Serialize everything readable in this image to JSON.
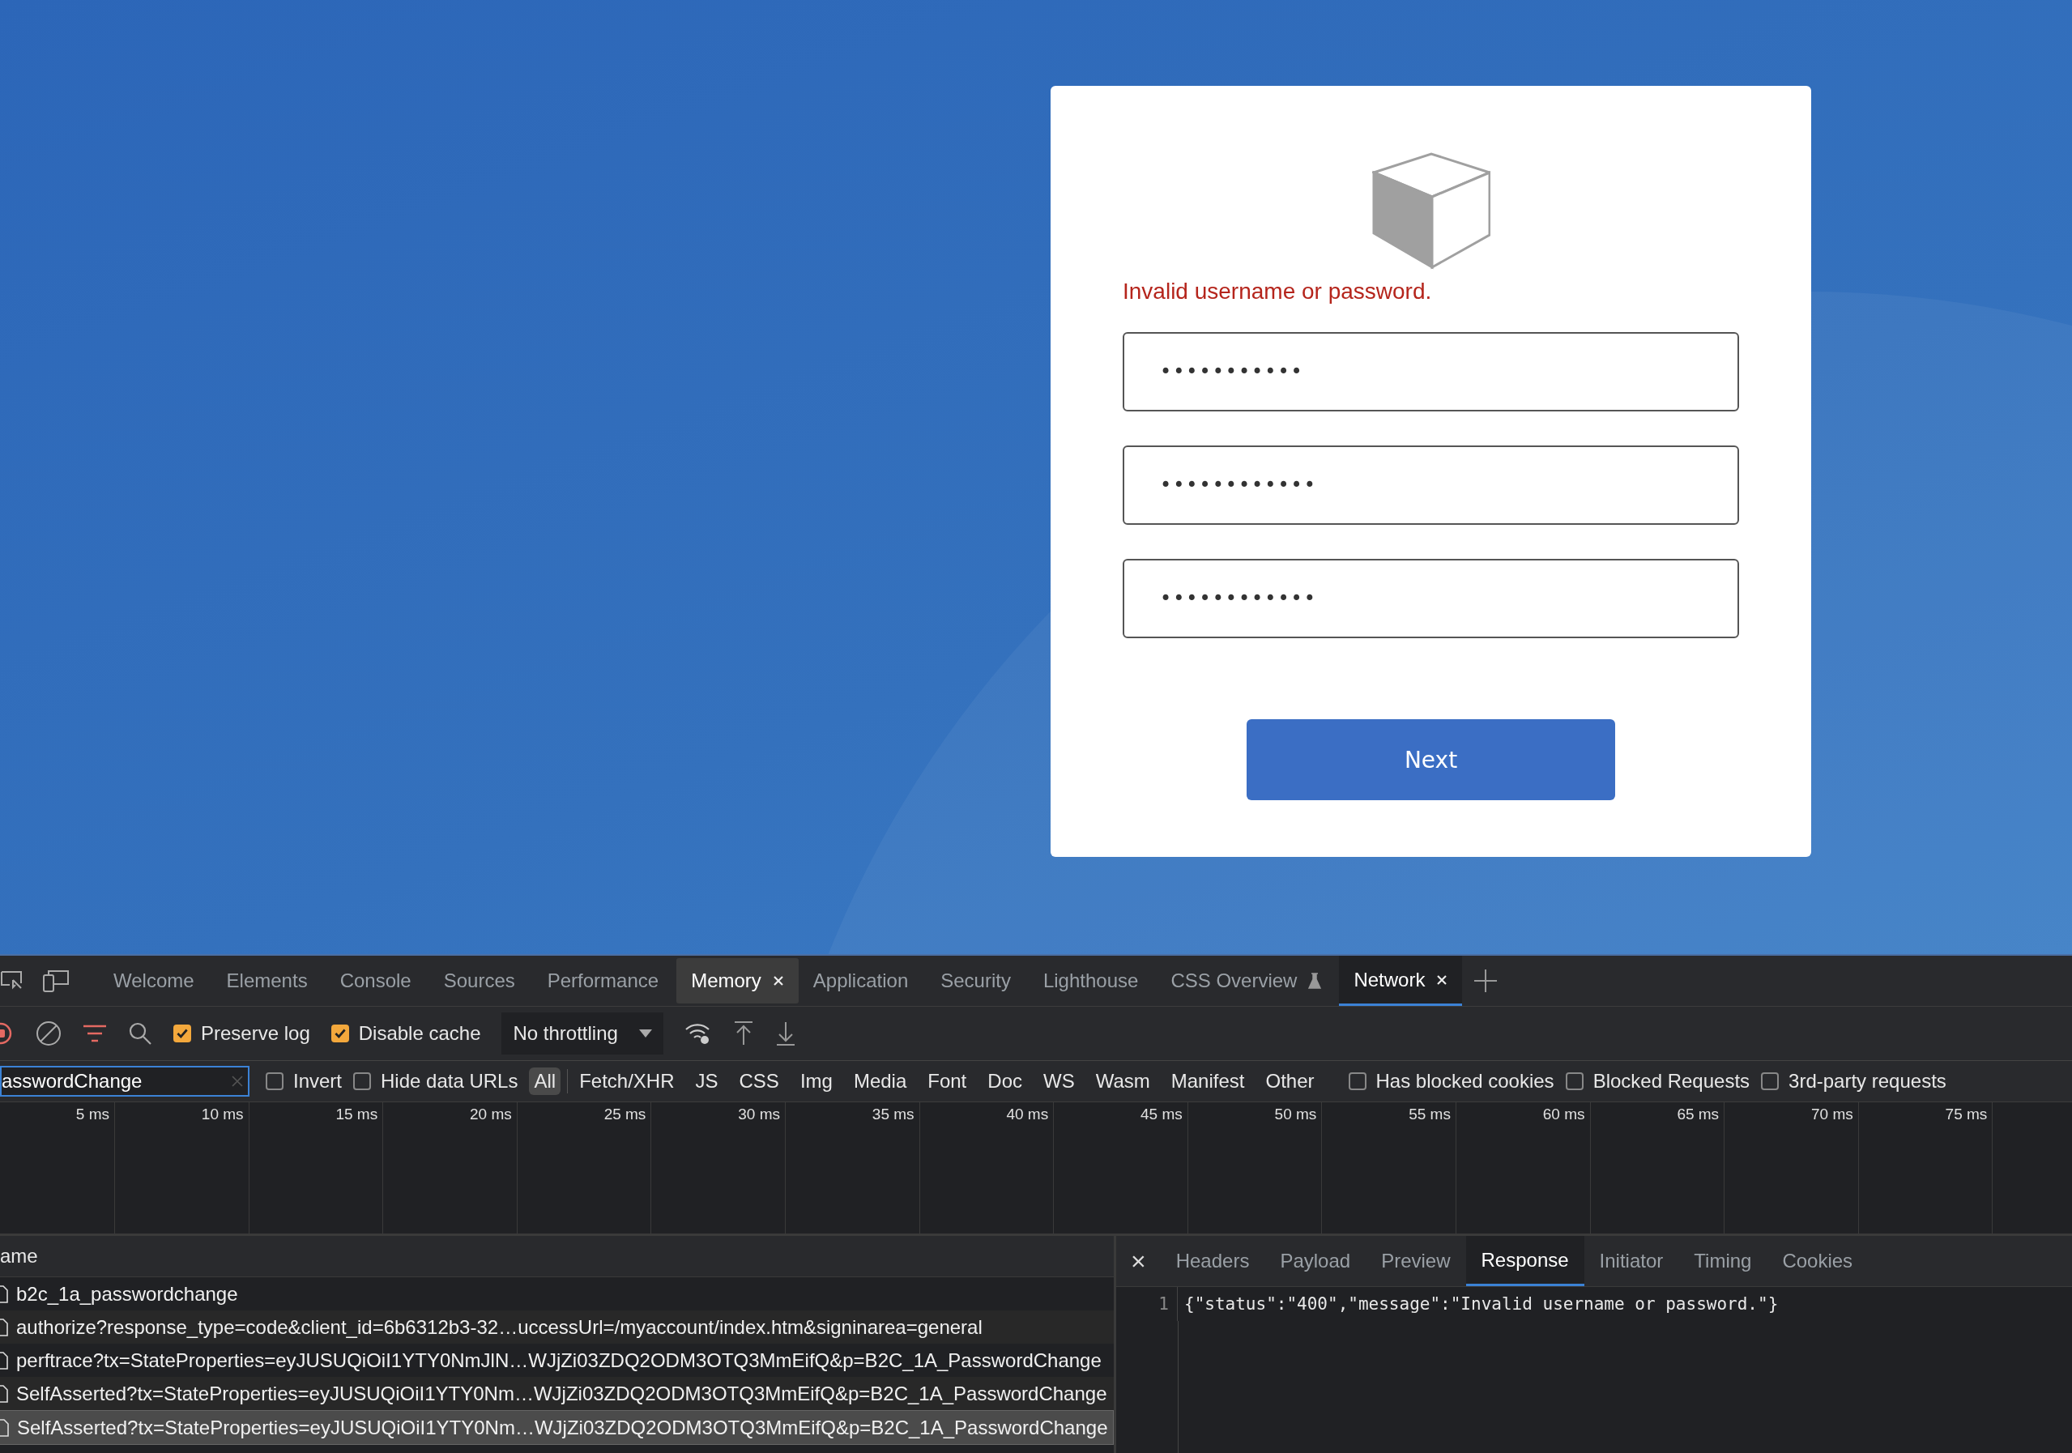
{
  "login": {
    "error": "Invalid username or password.",
    "fields": [
      {
        "value": "•••••••••••"
      },
      {
        "value": "••••••••••••"
      },
      {
        "value": "••••••••••••"
      }
    ],
    "button": "Next"
  },
  "devtools": {
    "tabs": [
      {
        "label": "Welcome",
        "selected": false,
        "kind": "plain"
      },
      {
        "label": "Elements",
        "selected": false,
        "kind": "plain"
      },
      {
        "label": "Console",
        "selected": false,
        "kind": "plain"
      },
      {
        "label": "Sources",
        "selected": false,
        "kind": "plain"
      },
      {
        "label": "Performance",
        "selected": false,
        "kind": "plain"
      },
      {
        "label": "Memory",
        "selected": false,
        "kind": "closable"
      },
      {
        "label": "Application",
        "selected": false,
        "kind": "plain"
      },
      {
        "label": "Security",
        "selected": false,
        "kind": "plain"
      },
      {
        "label": "Lighthouse",
        "selected": false,
        "kind": "plain"
      },
      {
        "label": "CSS Overview",
        "selected": false,
        "kind": "experimental"
      },
      {
        "label": "Network",
        "selected": true,
        "kind": "closable"
      }
    ],
    "toolbar": {
      "options": [
        {
          "label": "Preserve log",
          "checked": true
        },
        {
          "label": "Disable cache",
          "checked": true
        }
      ],
      "throttling": "No throttling"
    },
    "filter": {
      "value": "asswordChange",
      "options_left": [
        {
          "label": "Invert",
          "checked": false
        },
        {
          "label": "Hide data URLs",
          "checked": false
        }
      ],
      "types": [
        {
          "label": "All",
          "selected": true
        },
        {
          "label": "Fetch/XHR",
          "selected": false
        },
        {
          "label": "JS",
          "selected": false
        },
        {
          "label": "CSS",
          "selected": false
        },
        {
          "label": "Img",
          "selected": false
        },
        {
          "label": "Media",
          "selected": false
        },
        {
          "label": "Font",
          "selected": false
        },
        {
          "label": "Doc",
          "selected": false
        },
        {
          "label": "WS",
          "selected": false
        },
        {
          "label": "Wasm",
          "selected": false
        },
        {
          "label": "Manifest",
          "selected": false
        },
        {
          "label": "Other",
          "selected": false
        }
      ],
      "options_right": [
        {
          "label": "Has blocked cookies",
          "checked": false
        },
        {
          "label": "Blocked Requests",
          "checked": false
        },
        {
          "label": "3rd-party requests",
          "checked": false
        }
      ]
    },
    "timeline": {
      "ticks": [
        "5 ms",
        "10 ms",
        "15 ms",
        "20 ms",
        "25 ms",
        "30 ms",
        "35 ms",
        "40 ms",
        "45 ms",
        "50 ms",
        "55 ms",
        "60 ms",
        "65 ms",
        "70 ms",
        "75 ms"
      ]
    },
    "requests": {
      "column": "ame",
      "rows": [
        {
          "name": "b2c_1a_passwordchange",
          "selected": false
        },
        {
          "name": "authorize?response_type=code&client_id=6b6312b3-32…uccessUrl=/myaccount/index.htm&signinarea=general",
          "selected": false
        },
        {
          "name": "perftrace?tx=StateProperties=eyJUSUQiOiI1YTY0NmJlN…WJjZi03ZDQ2ODM3OTQ3MmEifQ&p=B2C_1A_PasswordChange",
          "selected": false
        },
        {
          "name": "SelfAsserted?tx=StateProperties=eyJUSUQiOiI1YTY0Nm…WJjZi03ZDQ2ODM3OTQ3MmEifQ&p=B2C_1A_PasswordChange",
          "selected": false
        },
        {
          "name": "SelfAsserted?tx=StateProperties=eyJUSUQiOiI1YTY0Nm…WJjZi03ZDQ2ODM3OTQ3MmEifQ&p=B2C_1A_PasswordChange",
          "selected": true
        }
      ]
    },
    "details": {
      "close": "×",
      "tabs": [
        {
          "label": "Headers",
          "selected": false
        },
        {
          "label": "Payload",
          "selected": false
        },
        {
          "label": "Preview",
          "selected": false
        },
        {
          "label": "Response",
          "selected": true
        },
        {
          "label": "Initiator",
          "selected": false
        },
        {
          "label": "Timing",
          "selected": false
        },
        {
          "label": "Cookies",
          "selected": false
        }
      ],
      "lines": [
        {
          "number": "1",
          "text": "{\"status\":\"400\",\"message\":\"Invalid username or password.\"}"
        }
      ]
    }
  }
}
